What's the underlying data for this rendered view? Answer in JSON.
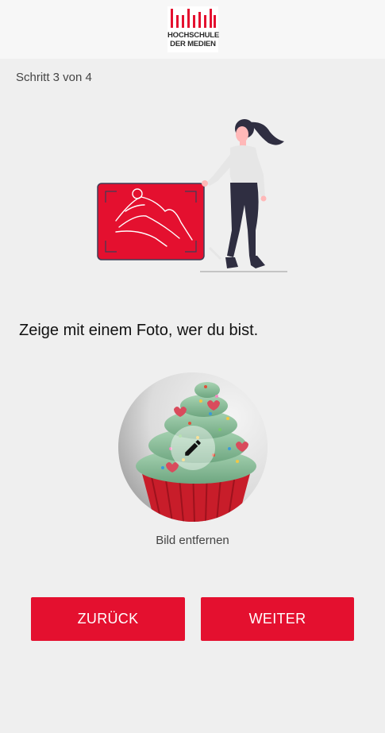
{
  "header": {
    "logo": {
      "line1": "HOCHSCHULE",
      "line2": "DER MEDIEN",
      "brand_color": "#e4102f"
    }
  },
  "progress": {
    "label": "Schritt 3 von 4",
    "current_step": 3,
    "total_steps": 4
  },
  "prompt": "Zeige mit einem Foto, wer du bist.",
  "photo": {
    "edit_icon": "pencil-icon",
    "remove_label": "Bild entfernen"
  },
  "buttons": {
    "back_label": "ZURÜCK",
    "next_label": "WEITER",
    "color": "#e4102f"
  }
}
